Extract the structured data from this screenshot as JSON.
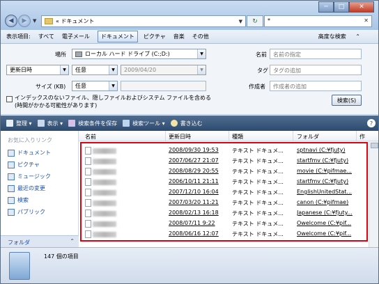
{
  "window": {
    "buttons": {
      "minimize": "─",
      "maximize": "□",
      "close": "✕"
    }
  },
  "nav": {
    "back_icon": "arrow-left-icon",
    "forward_icon": "arrow-right-icon",
    "address": "« ドキュメント",
    "search_value": "*"
  },
  "show_bar": {
    "label": "表示項目:",
    "items": [
      "すべて",
      "電子メール",
      "ドキュメント",
      "ピクチャ",
      "音楽",
      "その他"
    ],
    "active_index": 2,
    "advanced": "高度な検索"
  },
  "advanced": {
    "location_label": "場所",
    "location_value": "ローカル ハード ドライブ (C:;D:)",
    "date_field": "更新日時",
    "date_op": "任意",
    "date_value": "2009/04/20",
    "size_label": "サイズ (KB)",
    "size_op": "任意",
    "name_label": "名前",
    "name_placeholder": "名前の指定",
    "tag_label": "タグ",
    "tag_placeholder": "タグの追加",
    "author_label": "作成者",
    "author_placeholder": "作成者の追加",
    "index_checkbox": "インデックスのないファイル、隠しファイルおよびシステム ファイルを含める (時間がかかる可能性があります)",
    "search_button": "検索(S)"
  },
  "toolbar": {
    "organize": "整理",
    "view": "表示",
    "save_search": "検索条件を保存",
    "search_tools": "検索ツール",
    "burn": "書き込む"
  },
  "favorites": {
    "header": "お気に入りリンク",
    "items": [
      "ドキュメント",
      "ピクチャ",
      "ミュージック",
      "最近の変更",
      "検索",
      "パブリック"
    ]
  },
  "folder_bar": "フォルダ",
  "columns": [
    "名前",
    "更新日時",
    "種類",
    "フォルダ",
    "作"
  ],
  "rows": [
    {
      "date": "2008/09/30 19:53",
      "type": "テキスト ドキュメ...",
      "folder": "sptnavi (C:¥fjuty)"
    },
    {
      "date": "2007/06/27 21:07",
      "type": "テキスト ドキュメ...",
      "folder": "startfmv (C:¥fjuty)"
    },
    {
      "date": "2008/08/29 20:55",
      "type": "テキスト ドキュメ...",
      "folder": "movie (C:¥pifmae..."
    },
    {
      "date": "2006/10/11 21:11",
      "type": "テキスト ドキュメ...",
      "folder": "startfmv (C:¥fjuty)"
    },
    {
      "date": "2007/12/10 16:04",
      "type": "テキスト ドキュメ...",
      "folder": "EnglishUnitedStat..."
    },
    {
      "date": "2007/03/20 11:21",
      "type": "テキスト ドキュメ...",
      "folder": "canon (C:¥pifmae)"
    },
    {
      "date": "2008/02/13 16:18",
      "type": "テキスト ドキュメ...",
      "folder": "Japanese (C:¥fjuty..."
    },
    {
      "date": "2008/07/11 9:22",
      "type": "テキスト ドキュメ...",
      "folder": "Owelcome (C:¥pif..."
    },
    {
      "date": "2008/06/16 12:07",
      "type": "テキスト ドキュメ...",
      "folder": "Owelcome (C:¥pif..."
    }
  ],
  "status": {
    "count": "147 個の項目"
  },
  "colors": {
    "toolbar": "#3a577c",
    "highlight_box": "#e0000f",
    "link": "#1a4da0"
  }
}
